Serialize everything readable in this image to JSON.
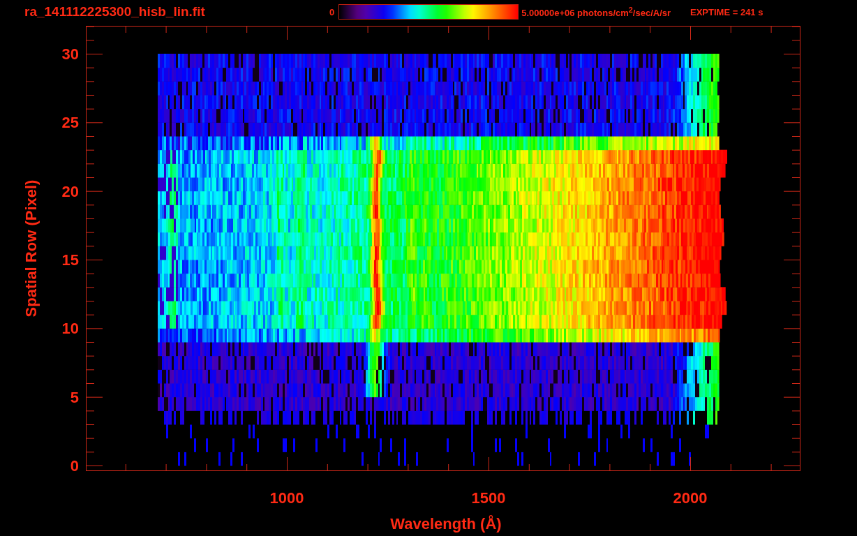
{
  "title": "ra_141112225300_hisb_lin.fit",
  "colorbar": {
    "min_label": "0",
    "max_label": "5.00000e+06 photons/cm$^{2}$/sec/A/sr"
  },
  "exposure": "EXPTIME = 241 s",
  "x_axis": {
    "label": "Wavelength (Å)",
    "tick_labels": [
      "1000",
      "1500",
      "2000"
    ]
  },
  "y_axis": {
    "label": "Spatial Row (Pixel)",
    "tick_labels": [
      "30",
      "25",
      "20",
      "15",
      "10",
      "5",
      "0"
    ]
  }
}
